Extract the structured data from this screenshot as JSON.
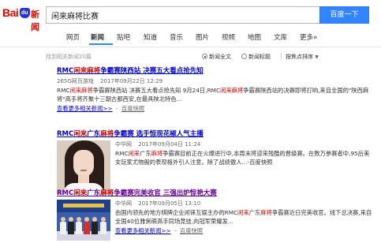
{
  "logo": {
    "text_bai": "Bai",
    "text_du": "du",
    "text_section": "新闻"
  },
  "search": {
    "query": "闲来麻将比赛",
    "button": "百度一下"
  },
  "tabs": [
    {
      "label": "网页",
      "active": false
    },
    {
      "label": "新闻",
      "active": true
    },
    {
      "label": "贴吧",
      "active": false
    },
    {
      "label": "知道",
      "active": false
    },
    {
      "label": "音乐",
      "active": false
    },
    {
      "label": "图片",
      "active": false
    },
    {
      "label": "视频",
      "active": false
    },
    {
      "label": "地图",
      "active": false
    },
    {
      "label": "文库",
      "active": false
    },
    {
      "label": "更多»",
      "active": false
    }
  ],
  "results_bar": {
    "found_text": "找到相关新闻20篇",
    "option_full": "新闻全文",
    "option_title": "新闻标题",
    "sort_label": "按焦点排序",
    "sort_arrow": "▼"
  },
  "results": [
    {
      "title_pre": "RMC",
      "title_em": "闲来麻将",
      "title_post": "争霸赛陕西站 决赛五大看点抢先知",
      "source": "265G网页游戏",
      "date": "2017年09月22日 12:29",
      "abstract_parts": [
        {
          "t": "RMC",
          "em": false
        },
        {
          "t": "闲来麻将",
          "em": true
        },
        {
          "t": "争霸赛陕西站 决赛五大看点抢先知 9月24日,RMC",
          "em": false
        },
        {
          "t": "闲来麻将",
          "em": true
        },
        {
          "t": "争霸赛陕西站的决赛即将打响,来自全国的\"陕西麻将\"高手将齐聚十三朝古都西安,在最具陕北特色...",
          "em": false
        }
      ],
      "more_link": "查看更多相关新闻>>",
      "dash": "-",
      "snapshot": "百度快照"
    },
    {
      "title_pre": "RMC",
      "title_em": "闲来",
      "title_mid": "广东",
      "title_em2": "麻将",
      "title_post": "争霸赛 选手惊现花椒人气主播",
      "source": "中华网",
      "date": "2017年09月04日 11:24",
      "abstract_parts": [
        {
          "t": "RMC",
          "em": false
        },
        {
          "t": "闲来",
          "em": true
        },
        {
          "t": "广东",
          "em": false
        },
        {
          "t": "麻将",
          "em": true
        },
        {
          "t": "争霸赛目前正在火爆进行中,本周末将迎来残酷的晋级赛。在数万参赛者中,95后美女玩家尤物般的表现格外引人注意。除了战绩傲人...",
          "em": false
        }
      ],
      "dash": "-",
      "snapshot": "百度快照"
    },
    {
      "title_pre": "RMC",
      "title_em": "闲来",
      "title_mid": "广东",
      "title_em2": "麻将",
      "title_post": "争霸赛完美收官 三强出炉惊艳大赛",
      "source": "中华网",
      "date": "2017年09月05日 13:10",
      "abstract_parts": [
        {
          "t": "由国内领先的地方棋牌企业闲徕互娱主办的RMC",
          "em": false
        },
        {
          "t": "闲来",
          "em": true
        },
        {
          "t": "广东",
          "em": false
        },
        {
          "t": "麻将",
          "em": true
        },
        {
          "t": "争霸赛近日完美收官。线下总决赛,来自全国40位雅俐萌高手同场竞技,向冠军荣耀发...",
          "em": false
        }
      ],
      "more_link": "查看更多相关新闻>>",
      "dash": "-",
      "snapshot": "百度快照"
    }
  ],
  "colors": {
    "accent": "#3385ff",
    "link": "#0000cc",
    "highlight": "#cc0000",
    "visited": "#660099"
  }
}
